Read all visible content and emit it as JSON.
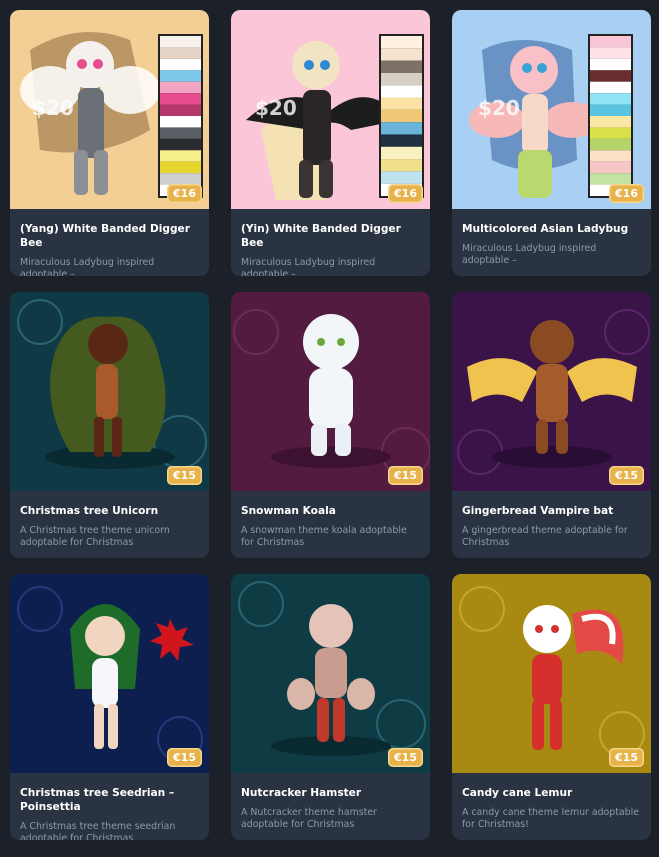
{
  "cards": [
    {
      "title": "(Yang) White Banded Digger Bee",
      "description": "Miraculous Ladybug inspired adoptable –",
      "price": "€16",
      "watermark": "$20",
      "bg": "#f3cf95",
      "swatches": [
        "#f8f2ee",
        "#e6d4c6",
        "#ffffff",
        "#7dc7ea",
        "#f2a5c3",
        "#e74d8c",
        "#b2386a",
        "#ffffff",
        "#5a5f66",
        "#2a2c30",
        "#f7f08a",
        "#e7d42c",
        "#cfcfcf",
        "#ffffff"
      ]
    },
    {
      "title": "(Yin) White Banded Digger Bee",
      "description": "Miraculous Ladybug inspired adoptable –",
      "price": "€16",
      "watermark": "$20",
      "bg": "#fbc6d8",
      "swatches": [
        "#fff0e0",
        "#f5e3cf",
        "#7d7168",
        "#d8cfc3",
        "#ffffff",
        "#fce2a4",
        "#f1c875",
        "#6ab4d9",
        "#1f3142",
        "#f7f0c0",
        "#f0e08a",
        "#bfe2ef",
        "#ffffff"
      ]
    },
    {
      "title": "Multicolored Asian Ladybug",
      "description": "Miraculous Ladybug inspired adoptable –",
      "price": "€16",
      "watermark": "$20",
      "bg": "#a9cff3",
      "swatches": [
        "#f9c6d6",
        "#ffe1e8",
        "#ffffff",
        "#6a2e2e",
        "#ffffff",
        "#8fe3f2",
        "#5bc4e2",
        "#fbe7a6",
        "#d9e14a",
        "#b6d36a",
        "#fde0c8",
        "#f7c7c7",
        "#c3e3a2",
        "#ffffff"
      ]
    },
    {
      "title": "Christmas tree Unicorn",
      "description": "A Christmas tree theme unicorn adoptable for Christmas",
      "price": "€15",
      "bg": "#0f3a45"
    },
    {
      "title": "Snowman Koala",
      "description": "A snowman theme koala adoptable for Christmas",
      "price": "€15",
      "bg": "#521b3f"
    },
    {
      "title": "Gingerbread Vampire bat",
      "description": "A gingerbread theme adoptable for Christmas",
      "price": "€15",
      "bg": "#3a1448"
    },
    {
      "title": "Christmas tree Seedrian – Poinsettia",
      "description": "A Christmas tree theme seedrian adoptable for Christmas",
      "price": "€15",
      "bg": "#0c1f4f"
    },
    {
      "title": "Nutcracker Hamster",
      "description": "A Nutcracker theme hamster adoptable for Christmas",
      "price": "€15",
      "bg": "#0f3b44"
    },
    {
      "title": "Candy cane Lemur",
      "description": "A candy cane theme lemur adoptable for Christmas!",
      "price": "€15",
      "bg": "#a88a12"
    }
  ]
}
